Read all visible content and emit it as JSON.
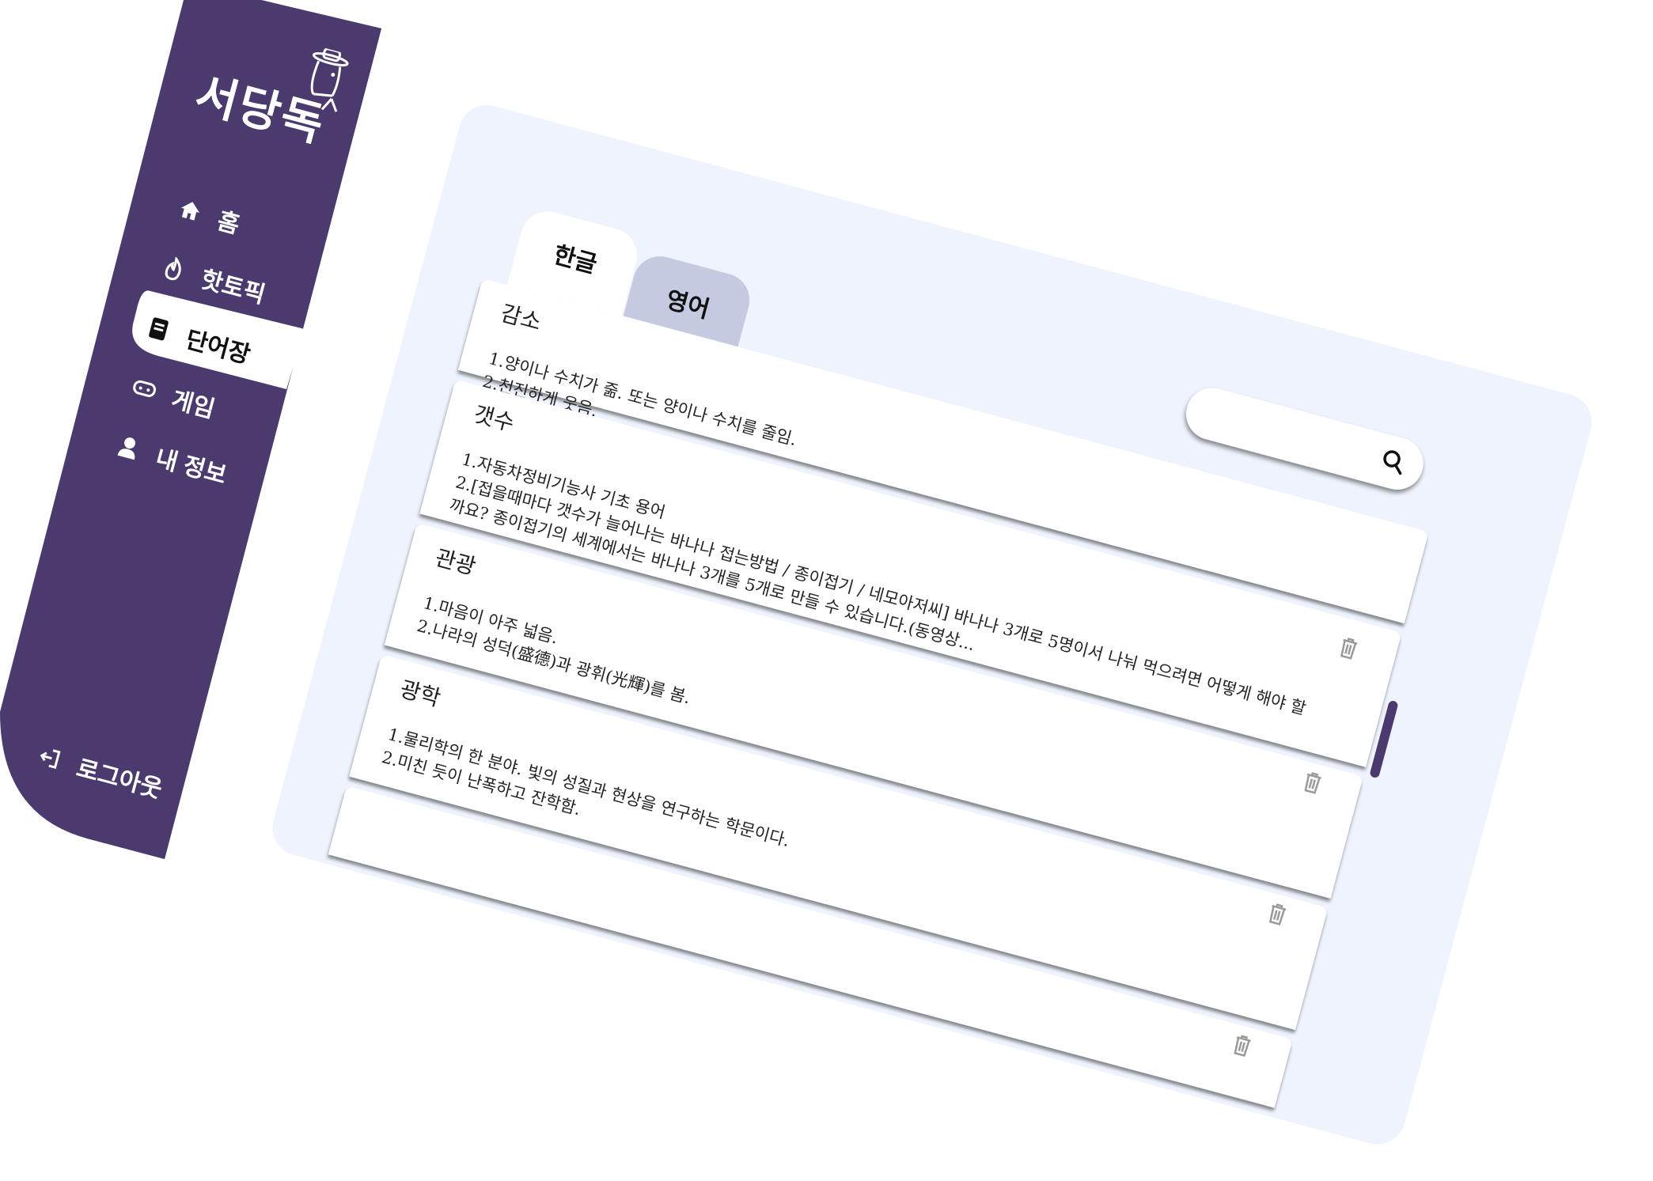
{
  "app": {
    "logo_text": "서당독",
    "colors": {
      "sidebar": "#4a3a6e",
      "panel": "#eef3fd",
      "tab_inactive": "#c4cbe0",
      "active_bg": "#ffffff"
    }
  },
  "sidebar": {
    "items": [
      {
        "label": "홈",
        "icon": "home-icon"
      },
      {
        "label": "핫토픽",
        "icon": "fire-icon"
      },
      {
        "label": "단어장",
        "icon": "book-icon",
        "active": true
      },
      {
        "label": "게임",
        "icon": "gamepad-icon"
      },
      {
        "label": "내 정보",
        "icon": "user-icon"
      }
    ],
    "logout_label": "로그아웃"
  },
  "tabs": [
    {
      "label": "한글",
      "active": true
    },
    {
      "label": "영어",
      "active": false
    }
  ],
  "search": {
    "placeholder": "",
    "value": ""
  },
  "words": [
    {
      "word": "감소",
      "defs": [
        "1.양이나 수치가 줆. 또는 양이나 수치를 줄임.",
        "2.천진하게 웃음."
      ]
    },
    {
      "word": "갯수",
      "defs": [
        "1.자동차정비기능사 기초 용어",
        "2.[접을때마다 갯수가 늘어나는 바나나 접는방법 / 종이접기 / 네모아저씨] 바나나 3개로 5명이서 나눠 먹으려면 어떻게 해야 할까요? 종이접기의 세계에서는 바나나 3개를 5개로 만들 수 있습니다.(동영상..."
      ]
    },
    {
      "word": "관광",
      "defs": [
        "1.마음이 아주 넓음.",
        "2.나라의 성덕(盛德)과 광휘(光輝)를 봄."
      ]
    },
    {
      "word": "광학",
      "defs": [
        "1.물리학의 한 분야. 빛의 성질과 현상을 연구하는 학문이다.",
        "2.미친 듯이 난폭하고 잔학함."
      ]
    }
  ]
}
